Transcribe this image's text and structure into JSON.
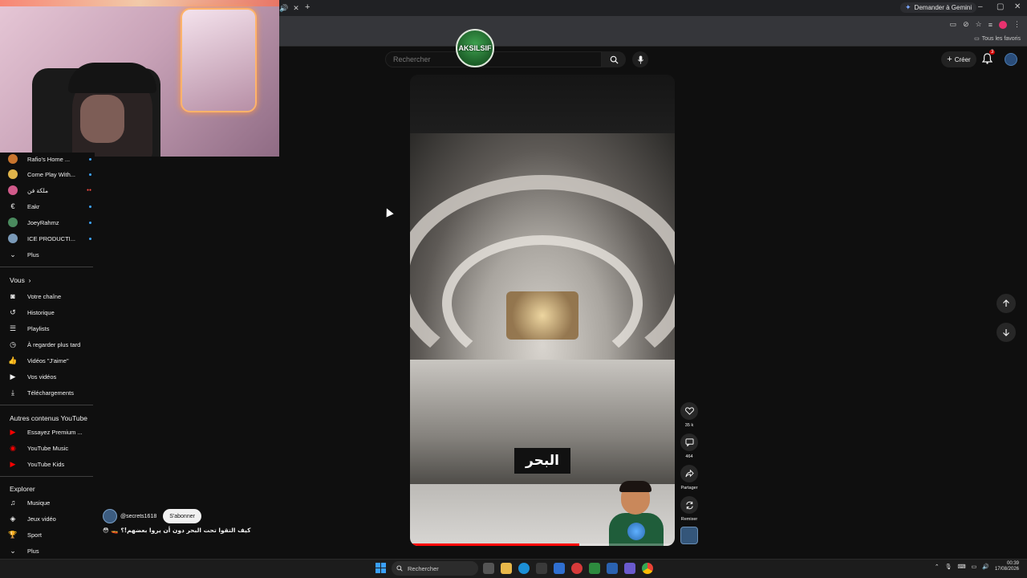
{
  "browser": {
    "gemini_label": "Demander à Gemini",
    "favorites_label": "Tous les favoris"
  },
  "logo": {
    "text": "AKSILSIF"
  },
  "search": {
    "placeholder": "Rechercher"
  },
  "header": {
    "create_label": "Créer",
    "notification_count": "3"
  },
  "sidebar": {
    "subscriptions": [
      {
        "label": "Rafio's Home ...",
        "color": "#c9752e",
        "status": "new"
      },
      {
        "label": "Come Play With...",
        "color": "#e0b44a",
        "status": "new"
      },
      {
        "label": "ملكة فن",
        "color": "#d15a8a",
        "status": "live"
      },
      {
        "label": "Eakr",
        "color": "#444444",
        "status": "new"
      },
      {
        "label": "JoeyRahmz",
        "color": "#4a8a5e",
        "status": "new"
      },
      {
        "label": "ICE PRODUCTI...",
        "color": "#7a9ab8",
        "status": "new"
      }
    ],
    "more_label": "Plus",
    "you_section": "Vous",
    "you_items": [
      {
        "label": "Votre chaîne",
        "icon": "channel-icon"
      },
      {
        "label": "Historique",
        "icon": "history-icon"
      },
      {
        "label": "Playlists",
        "icon": "playlist-icon"
      },
      {
        "label": "À regarder plus tard",
        "icon": "watch-later-icon"
      },
      {
        "label": "Vidéos \"J'aime\"",
        "icon": "like-icon"
      },
      {
        "label": "Vos vidéos",
        "icon": "video-icon"
      },
      {
        "label": "Téléchargements",
        "icon": "download-icon"
      }
    ],
    "other_section": "Autres contenus YouTube",
    "other_items": [
      {
        "label": "Essayez Premium ...",
        "icon": "youtube-premium-icon"
      },
      {
        "label": "YouTube Music",
        "icon": "youtube-music-icon"
      },
      {
        "label": "YouTube Kids",
        "icon": "youtube-kids-icon"
      }
    ],
    "explore_section": "Explorer",
    "explore_items": [
      {
        "label": "Musique",
        "icon": "music-icon"
      },
      {
        "label": "Jeux vidéo",
        "icon": "gaming-icon"
      },
      {
        "label": "Sport",
        "icon": "trophy-icon"
      }
    ],
    "explore_more_label": "Plus"
  },
  "short": {
    "caption": "البحر",
    "progress": 0.64,
    "channel_handle": "@secrets1618",
    "subscribe_label": "S'abonner",
    "title": "😳 🚤 كيف التقوا تحت البحر دون أن يروا بعضهم!؟"
  },
  "actions": {
    "likes": "35 k",
    "comments": "464",
    "share_label": "Partager",
    "remix_label": "Remixer"
  },
  "taskbar": {
    "search_placeholder": "Rechercher",
    "time": "00:39",
    "date": "17/08/2026"
  }
}
